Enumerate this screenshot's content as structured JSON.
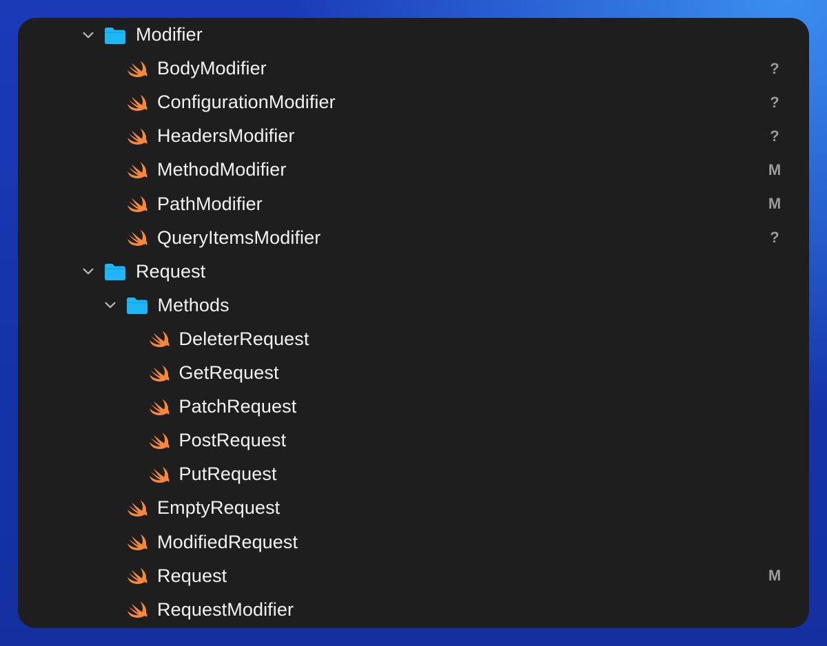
{
  "navigator": {
    "items": [
      {
        "label": "Modifier",
        "kind": "folder",
        "depth": 0,
        "expanded": true,
        "status": ""
      },
      {
        "label": "BodyModifier",
        "kind": "swift",
        "depth": 1,
        "status": "?"
      },
      {
        "label": "ConfigurationModifier",
        "kind": "swift",
        "depth": 1,
        "status": "?"
      },
      {
        "label": "HeadersModifier",
        "kind": "swift",
        "depth": 1,
        "status": "?"
      },
      {
        "label": "MethodModifier",
        "kind": "swift",
        "depth": 1,
        "status": "M"
      },
      {
        "label": "PathModifier",
        "kind": "swift",
        "depth": 1,
        "status": "M"
      },
      {
        "label": "QueryItemsModifier",
        "kind": "swift",
        "depth": 1,
        "status": "?"
      },
      {
        "label": "Request",
        "kind": "folder",
        "depth": 0,
        "expanded": true,
        "status": ""
      },
      {
        "label": "Methods",
        "kind": "folder",
        "depth": 1,
        "expanded": true,
        "status": ""
      },
      {
        "label": "DeleterRequest",
        "kind": "swift",
        "depth": 2,
        "status": ""
      },
      {
        "label": "GetRequest",
        "kind": "swift",
        "depth": 2,
        "status": ""
      },
      {
        "label": "PatchRequest",
        "kind": "swift",
        "depth": 2,
        "status": ""
      },
      {
        "label": "PostRequest",
        "kind": "swift",
        "depth": 2,
        "status": ""
      },
      {
        "label": "PutRequest",
        "kind": "swift",
        "depth": 2,
        "status": ""
      },
      {
        "label": "EmptyRequest",
        "kind": "swift",
        "depth": 1,
        "status": ""
      },
      {
        "label": "ModifiedRequest",
        "kind": "swift",
        "depth": 1,
        "status": ""
      },
      {
        "label": "Request",
        "kind": "swift",
        "depth": 1,
        "status": "M"
      },
      {
        "label": "RequestModifier",
        "kind": "swift",
        "depth": 1,
        "status": ""
      }
    ]
  },
  "colors": {
    "panel_bg": "#1e1e1e",
    "folder": "#1fb6f5",
    "swift_orange": "#f7883b",
    "status_text": "#9b9b9b",
    "label_text": "#f2f2f2"
  },
  "icons": {
    "folder": "folder-icon",
    "swift": "swift-file-icon",
    "disclosure": "chevron-down-icon"
  }
}
